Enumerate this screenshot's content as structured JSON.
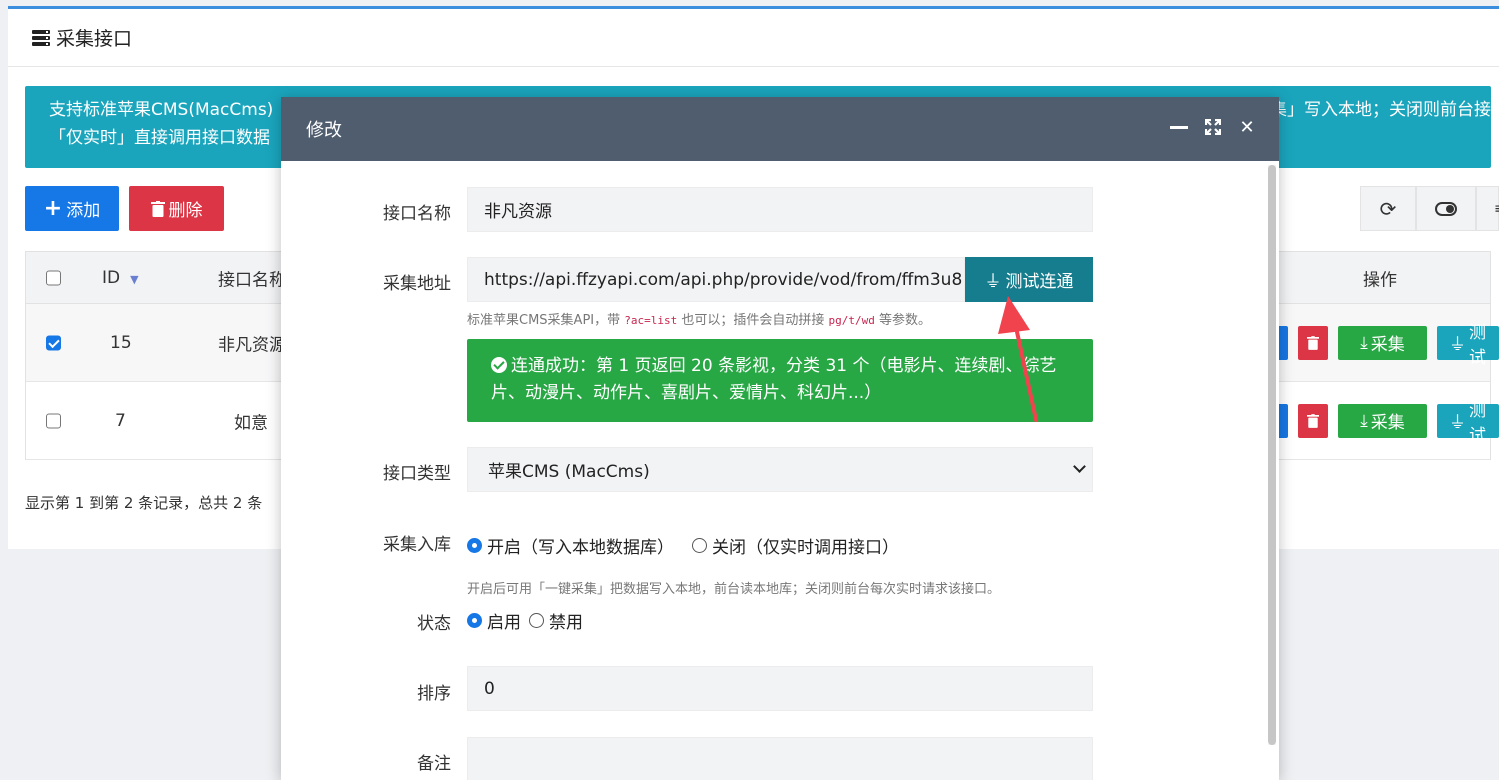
{
  "page": {
    "title": "采集接口",
    "info_line1": "支持标准苹果CMS(MacCms)",
    "info_line1_right": "集」写入本地；关闭则前台接",
    "info_line2": "「仅实时」直接调用接口数据",
    "add_label": "添加",
    "delete_label": "删除",
    "footer": "显示第 1 到第 2 条记录，总共 2 条"
  },
  "table": {
    "headers": {
      "id": "ID",
      "name": "接口名称",
      "ops": "操作"
    },
    "rows": [
      {
        "checked": true,
        "id": "15",
        "name": "非凡资源",
        "collect": "采集",
        "test": "测试"
      },
      {
        "checked": false,
        "id": "7",
        "name": "如意",
        "collect": "采集",
        "test": "测试"
      }
    ]
  },
  "modal": {
    "title": "修改",
    "fields": {
      "name_label": "接口名称",
      "name_value": "非凡资源",
      "url_label": "采集地址",
      "url_value": "https://api.ffzyapi.com/api.php/provide/vod/from/ffm3u8",
      "test_label": "测试连通",
      "url_hint_pre": "标准苹果CMS采集API，带",
      "url_hint_code1": "?ac=list",
      "url_hint_mid": "也可以；插件会自动拼接",
      "url_hint_code2": "pg/t/wd",
      "url_hint_post": "等参数。",
      "success_text": "连通成功：第 1 页返回 20 条影视，分类 31 个（电影片、连续剧、综艺片、动漫片、动作片、喜剧片、爱情片、科幻片...）",
      "type_label": "接口类型",
      "type_value": "苹果CMS (MacCms)",
      "store_label": "采集入库",
      "store_on": "开启（写入本地数据库）",
      "store_off": "关闭（仅实时调用接口）",
      "store_hint": "开启后可用「一键采集」把数据写入本地，前台读本地库；关闭则前台每次实时请求该接口。",
      "status_label": "状态",
      "status_on": "启用",
      "status_off": "禁用",
      "sort_label": "排序",
      "sort_value": "0",
      "remark_label": "备注"
    }
  },
  "colors": {
    "accent": "#1677e6",
    "danger": "#dc3545",
    "success": "#28a745",
    "info": "#1aa5bd",
    "modal_header": "#4f5d6e",
    "arrow": "#f0434e"
  }
}
